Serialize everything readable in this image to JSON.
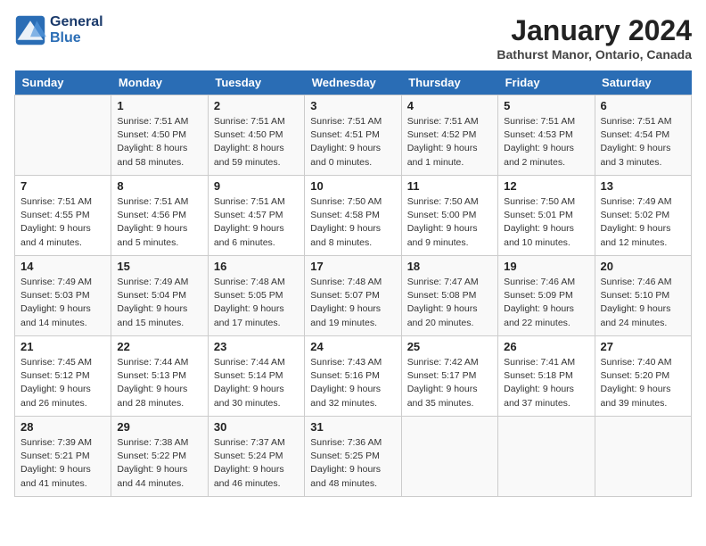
{
  "header": {
    "logo_line1": "General",
    "logo_line2": "Blue",
    "month_title": "January 2024",
    "location": "Bathurst Manor, Ontario, Canada"
  },
  "days_of_week": [
    "Sunday",
    "Monday",
    "Tuesday",
    "Wednesday",
    "Thursday",
    "Friday",
    "Saturday"
  ],
  "weeks": [
    [
      {
        "day": "",
        "content": ""
      },
      {
        "day": "1",
        "content": "Sunrise: 7:51 AM\nSunset: 4:50 PM\nDaylight: 8 hours\nand 58 minutes."
      },
      {
        "day": "2",
        "content": "Sunrise: 7:51 AM\nSunset: 4:50 PM\nDaylight: 8 hours\nand 59 minutes."
      },
      {
        "day": "3",
        "content": "Sunrise: 7:51 AM\nSunset: 4:51 PM\nDaylight: 9 hours\nand 0 minutes."
      },
      {
        "day": "4",
        "content": "Sunrise: 7:51 AM\nSunset: 4:52 PM\nDaylight: 9 hours\nand 1 minute."
      },
      {
        "day": "5",
        "content": "Sunrise: 7:51 AM\nSunset: 4:53 PM\nDaylight: 9 hours\nand 2 minutes."
      },
      {
        "day": "6",
        "content": "Sunrise: 7:51 AM\nSunset: 4:54 PM\nDaylight: 9 hours\nand 3 minutes."
      }
    ],
    [
      {
        "day": "7",
        "content": "Sunrise: 7:51 AM\nSunset: 4:55 PM\nDaylight: 9 hours\nand 4 minutes."
      },
      {
        "day": "8",
        "content": "Sunrise: 7:51 AM\nSunset: 4:56 PM\nDaylight: 9 hours\nand 5 minutes."
      },
      {
        "day": "9",
        "content": "Sunrise: 7:51 AM\nSunset: 4:57 PM\nDaylight: 9 hours\nand 6 minutes."
      },
      {
        "day": "10",
        "content": "Sunrise: 7:50 AM\nSunset: 4:58 PM\nDaylight: 9 hours\nand 8 minutes."
      },
      {
        "day": "11",
        "content": "Sunrise: 7:50 AM\nSunset: 5:00 PM\nDaylight: 9 hours\nand 9 minutes."
      },
      {
        "day": "12",
        "content": "Sunrise: 7:50 AM\nSunset: 5:01 PM\nDaylight: 9 hours\nand 10 minutes."
      },
      {
        "day": "13",
        "content": "Sunrise: 7:49 AM\nSunset: 5:02 PM\nDaylight: 9 hours\nand 12 minutes."
      }
    ],
    [
      {
        "day": "14",
        "content": "Sunrise: 7:49 AM\nSunset: 5:03 PM\nDaylight: 9 hours\nand 14 minutes."
      },
      {
        "day": "15",
        "content": "Sunrise: 7:49 AM\nSunset: 5:04 PM\nDaylight: 9 hours\nand 15 minutes."
      },
      {
        "day": "16",
        "content": "Sunrise: 7:48 AM\nSunset: 5:05 PM\nDaylight: 9 hours\nand 17 minutes."
      },
      {
        "day": "17",
        "content": "Sunrise: 7:48 AM\nSunset: 5:07 PM\nDaylight: 9 hours\nand 19 minutes."
      },
      {
        "day": "18",
        "content": "Sunrise: 7:47 AM\nSunset: 5:08 PM\nDaylight: 9 hours\nand 20 minutes."
      },
      {
        "day": "19",
        "content": "Sunrise: 7:46 AM\nSunset: 5:09 PM\nDaylight: 9 hours\nand 22 minutes."
      },
      {
        "day": "20",
        "content": "Sunrise: 7:46 AM\nSunset: 5:10 PM\nDaylight: 9 hours\nand 24 minutes."
      }
    ],
    [
      {
        "day": "21",
        "content": "Sunrise: 7:45 AM\nSunset: 5:12 PM\nDaylight: 9 hours\nand 26 minutes."
      },
      {
        "day": "22",
        "content": "Sunrise: 7:44 AM\nSunset: 5:13 PM\nDaylight: 9 hours\nand 28 minutes."
      },
      {
        "day": "23",
        "content": "Sunrise: 7:44 AM\nSunset: 5:14 PM\nDaylight: 9 hours\nand 30 minutes."
      },
      {
        "day": "24",
        "content": "Sunrise: 7:43 AM\nSunset: 5:16 PM\nDaylight: 9 hours\nand 32 minutes."
      },
      {
        "day": "25",
        "content": "Sunrise: 7:42 AM\nSunset: 5:17 PM\nDaylight: 9 hours\nand 35 minutes."
      },
      {
        "day": "26",
        "content": "Sunrise: 7:41 AM\nSunset: 5:18 PM\nDaylight: 9 hours\nand 37 minutes."
      },
      {
        "day": "27",
        "content": "Sunrise: 7:40 AM\nSunset: 5:20 PM\nDaylight: 9 hours\nand 39 minutes."
      }
    ],
    [
      {
        "day": "28",
        "content": "Sunrise: 7:39 AM\nSunset: 5:21 PM\nDaylight: 9 hours\nand 41 minutes."
      },
      {
        "day": "29",
        "content": "Sunrise: 7:38 AM\nSunset: 5:22 PM\nDaylight: 9 hours\nand 44 minutes."
      },
      {
        "day": "30",
        "content": "Sunrise: 7:37 AM\nSunset: 5:24 PM\nDaylight: 9 hours\nand 46 minutes."
      },
      {
        "day": "31",
        "content": "Sunrise: 7:36 AM\nSunset: 5:25 PM\nDaylight: 9 hours\nand 48 minutes."
      },
      {
        "day": "",
        "content": ""
      },
      {
        "day": "",
        "content": ""
      },
      {
        "day": "",
        "content": ""
      }
    ]
  ]
}
